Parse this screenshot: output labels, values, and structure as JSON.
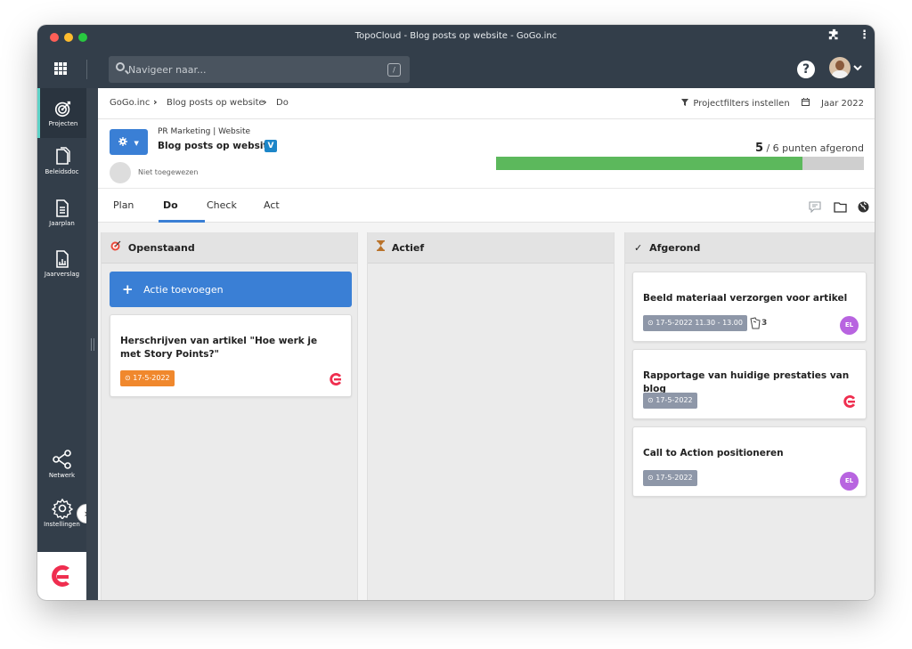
{
  "window": {
    "title": "TopoCloud - Blog posts op website - GoGo.inc"
  },
  "colors": {
    "accent": "#3a7fd5",
    "progress": "#5cb85c",
    "orange": "#f0882d",
    "dark": "#333e4a",
    "el_avatar": "#b864e0",
    "brand_red": "#ef2e4f"
  },
  "search": {
    "placeholder": "Navigeer naar...",
    "shortcut": "/"
  },
  "sidebar": {
    "items": [
      {
        "label": "Projecten",
        "icon": "target-icon"
      },
      {
        "label": "Beleidsdoc",
        "icon": "document-icon"
      },
      {
        "label": "Jaarplan",
        "icon": "list-document-icon"
      },
      {
        "label": "Jaarverslag",
        "icon": "chart-document-icon"
      },
      {
        "label": "Netwerk",
        "icon": "share-icon"
      },
      {
        "label": "Instellingen",
        "icon": "gear-icon"
      }
    ]
  },
  "breadcrumb": {
    "items": [
      "GoGo.inc",
      "Blog posts op website",
      "Do"
    ]
  },
  "filters": {
    "project_filters": "Projectfilters instellen",
    "year": "Jaar 2022"
  },
  "project": {
    "crumb": "PR Marketing | Website",
    "title": "Blog posts op website",
    "badge": "V",
    "assignee": "Niet toegewezen",
    "points_done": "5",
    "points_rest": "/ 6 punten afgerond",
    "progress": 0.833
  },
  "tabs": [
    "Plan",
    "Do",
    "Check",
    "Act"
  ],
  "columns": {
    "open": {
      "title": "Openstaand",
      "add_label": "Actie toevoegen",
      "cards": [
        {
          "title": "Herschrijven van artikel \"Hoe werk je met Story Points?\"",
          "date": "⊙ 17-5-2022"
        }
      ]
    },
    "active": {
      "title": "Actief"
    },
    "done": {
      "title": "Afgerond",
      "cards": [
        {
          "title": "Beeld materiaal verzorgen voor artikel",
          "date": "⊙ 17-5-2022 11.30 - 13.00",
          "attachments": "3",
          "avatar": "EL"
        },
        {
          "title": "Rapportage van huidige prestaties van blog",
          "date": "⊙ 17-5-2022"
        },
        {
          "title": "Call to Action positioneren",
          "date": "⊙ 17-5-2022",
          "avatar": "EL"
        }
      ]
    }
  }
}
